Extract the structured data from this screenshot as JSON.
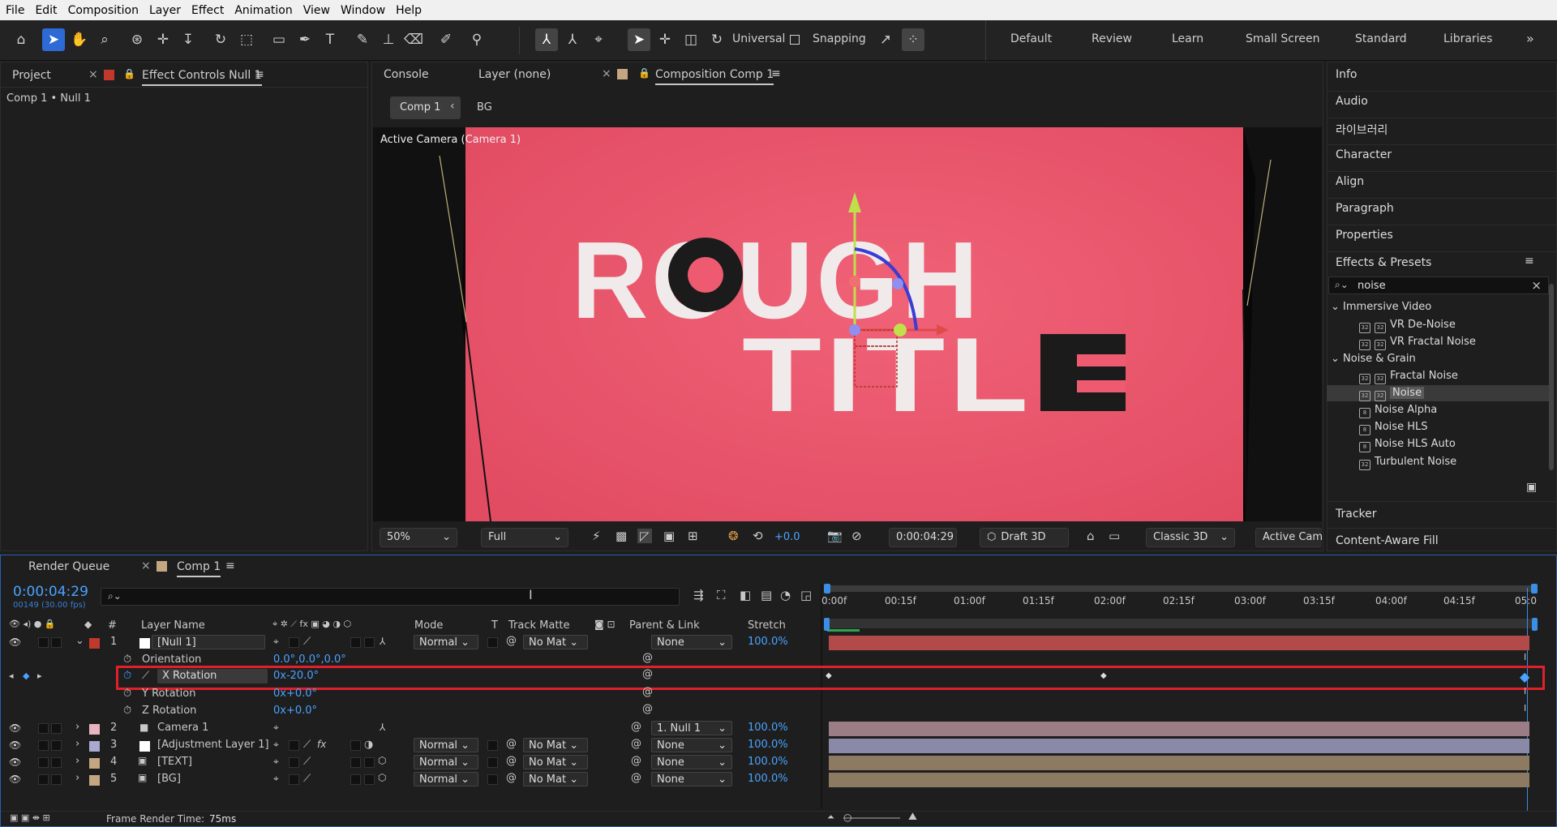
{
  "menu": [
    "File",
    "Edit",
    "Composition",
    "Layer",
    "Effect",
    "Animation",
    "View",
    "Window",
    "Help"
  ],
  "toolbar": {
    "axis_mode": "Universal",
    "snapping": "Snapping"
  },
  "workspaces": [
    "Default",
    "Review",
    "Learn",
    "Small Screen",
    "Standard",
    "Libraries"
  ],
  "left_panel": {
    "tab_project": "Project",
    "tab_effect": "Effect Controls Null 1",
    "breadcrumb": "Comp 1 • Null 1"
  },
  "center": {
    "tab_console": "Console",
    "tab_layer": "Layer (none)",
    "tab_comp": "Composition Comp 1",
    "sub_comp1": "Comp 1",
    "sub_bg": "BG",
    "camera_label": "Active Camera (Camera 1)",
    "title_line1": "ROUGH",
    "title_line2": "TITLE"
  },
  "viewer_controls": {
    "zoom": "50%",
    "resolution": "Full",
    "exposure": "+0.0",
    "timecode": "0:00:04:29",
    "renderer": "Draft 3D",
    "mode3d": "Classic 3D",
    "view": "Active Cam"
  },
  "right_panel": {
    "items": [
      "Info",
      "Audio",
      "라이브러리",
      "Character",
      "Align",
      "Paragraph",
      "Properties"
    ],
    "effects_title": "Effects & Presets",
    "search": "noise",
    "groups": [
      {
        "name": "Immersive Video",
        "items": [
          "VR De-Noise",
          "VR Fractal Noise"
        ]
      },
      {
        "name": "Noise & Grain",
        "items": [
          "Fractal Noise",
          "Noise",
          "Noise Alpha",
          "Noise HLS",
          "Noise HLS Auto",
          "Turbulent Noise"
        ]
      }
    ],
    "tracker": "Tracker",
    "content_fill": "Content-Aware Fill"
  },
  "timeline": {
    "tab_render": "Render Queue",
    "tab_comp": "Comp 1",
    "timecode": "0:00:04:29",
    "frame_info": "00149 (30.00 fps)",
    "headers": {
      "num": "#",
      "layer_name": "Layer Name",
      "mode": "Mode",
      "t": "T",
      "track_matte": "Track Matte",
      "parent": "Parent & Link",
      "stretch": "Stretch"
    },
    "ruler": [
      "0:00f",
      "00:15f",
      "01:00f",
      "01:15f",
      "02:00f",
      "02:15f",
      "03:00f",
      "03:15f",
      "04:00f",
      "04:15f",
      "05:0"
    ],
    "layers": [
      {
        "num": "1",
        "name": "[Null 1]",
        "color": "#c0392b",
        "mode": "Normal",
        "matte": "No Mat",
        "parent": "None",
        "stretch": "100.0%"
      },
      {
        "num": "2",
        "name": "Camera 1",
        "color": "#e8b4c0",
        "mode": "",
        "matte": "",
        "parent": "1. Null 1",
        "stretch": "100.0%"
      },
      {
        "num": "3",
        "name": "[Adjustment Layer 1]",
        "color": "#a9a9d1",
        "mode": "Normal",
        "matte": "No Mat",
        "parent": "None",
        "stretch": "100.0%"
      },
      {
        "num": "4",
        "name": "[TEXT]",
        "color": "#c4a680",
        "mode": "Normal",
        "matte": "No Mat",
        "parent": "None",
        "stretch": "100.0%"
      },
      {
        "num": "5",
        "name": "[BG]",
        "color": "#c4a680",
        "mode": "Normal",
        "matte": "No Mat",
        "parent": "None",
        "stretch": "100.0%"
      }
    ],
    "props": [
      {
        "name": "Orientation",
        "value": "0.0°,0.0°,0.0°"
      },
      {
        "name": "X Rotation",
        "value": "0x-20.0°"
      },
      {
        "name": "Y Rotation",
        "value": "0x+0.0°"
      },
      {
        "name": "Z Rotation",
        "value": "0x+0.0°"
      }
    ],
    "render_time_label": "Frame Render Time:",
    "render_time": "75ms"
  }
}
